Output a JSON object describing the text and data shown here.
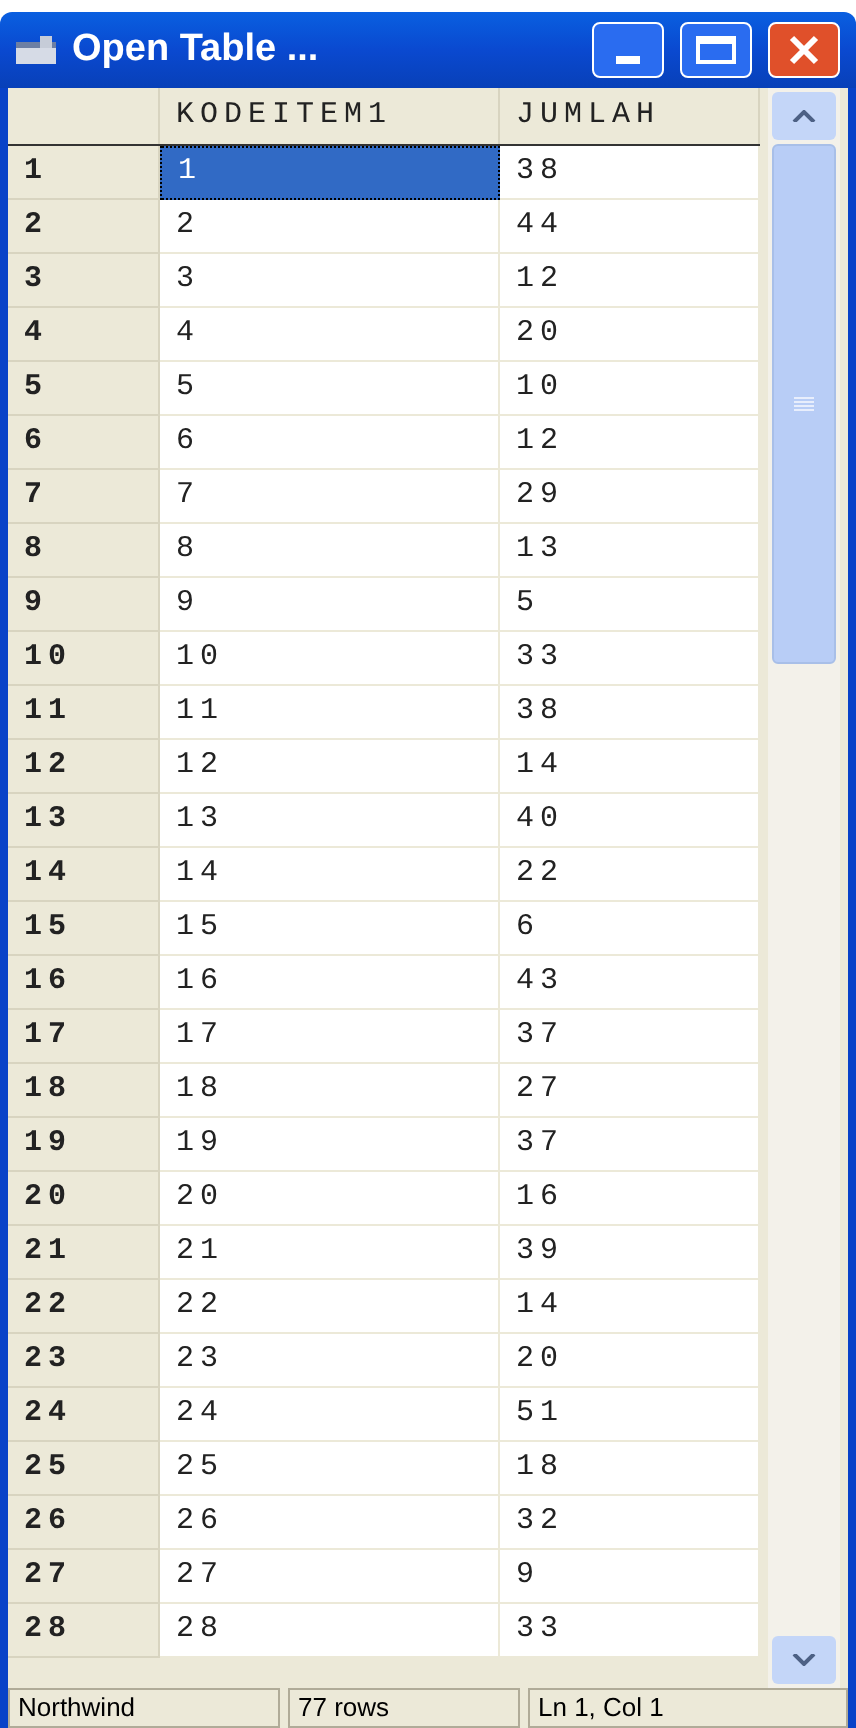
{
  "window": {
    "title": "Open Table ..."
  },
  "table": {
    "columns": [
      "KODEITEM1",
      "JUMLAH"
    ],
    "rows": [
      {
        "header": "1",
        "cells": [
          "1",
          "38"
        ],
        "selected": true
      },
      {
        "header": "2",
        "cells": [
          "2",
          "44"
        ],
        "selected": false
      },
      {
        "header": "3",
        "cells": [
          "3",
          "12"
        ],
        "selected": false
      },
      {
        "header": "4",
        "cells": [
          "4",
          "20"
        ],
        "selected": false
      },
      {
        "header": "5",
        "cells": [
          "5",
          "10"
        ],
        "selected": false
      },
      {
        "header": "6",
        "cells": [
          "6",
          "12"
        ],
        "selected": false
      },
      {
        "header": "7",
        "cells": [
          "7",
          "29"
        ],
        "selected": false
      },
      {
        "header": "8",
        "cells": [
          "8",
          "13"
        ],
        "selected": false
      },
      {
        "header": "9",
        "cells": [
          "9",
          "5"
        ],
        "selected": false
      },
      {
        "header": "10",
        "cells": [
          "10",
          "33"
        ],
        "selected": false
      },
      {
        "header": "11",
        "cells": [
          "11",
          "38"
        ],
        "selected": false
      },
      {
        "header": "12",
        "cells": [
          "12",
          "14"
        ],
        "selected": false
      },
      {
        "header": "13",
        "cells": [
          "13",
          "40"
        ],
        "selected": false
      },
      {
        "header": "14",
        "cells": [
          "14",
          "22"
        ],
        "selected": false
      },
      {
        "header": "15",
        "cells": [
          "15",
          "6"
        ],
        "selected": false
      },
      {
        "header": "16",
        "cells": [
          "16",
          "43"
        ],
        "selected": false
      },
      {
        "header": "17",
        "cells": [
          "17",
          "37"
        ],
        "selected": false
      },
      {
        "header": "18",
        "cells": [
          "18",
          "27"
        ],
        "selected": false
      },
      {
        "header": "19",
        "cells": [
          "19",
          "37"
        ],
        "selected": false
      },
      {
        "header": "20",
        "cells": [
          "20",
          "16"
        ],
        "selected": false
      },
      {
        "header": "21",
        "cells": [
          "21",
          "39"
        ],
        "selected": false
      },
      {
        "header": "22",
        "cells": [
          "22",
          "14"
        ],
        "selected": false
      },
      {
        "header": "23",
        "cells": [
          "23",
          "20"
        ],
        "selected": false
      },
      {
        "header": "24",
        "cells": [
          "24",
          "51"
        ],
        "selected": false
      },
      {
        "header": "25",
        "cells": [
          "25",
          "18"
        ],
        "selected": false
      },
      {
        "header": "26",
        "cells": [
          "26",
          "32"
        ],
        "selected": false
      },
      {
        "header": "27",
        "cells": [
          "27",
          "9"
        ],
        "selected": false
      },
      {
        "header": "28",
        "cells": [
          "28",
          "33"
        ],
        "selected": false
      }
    ]
  },
  "status_bar": [
    "Northwind",
    "77 rows",
    "Ln 1, Col 1"
  ]
}
